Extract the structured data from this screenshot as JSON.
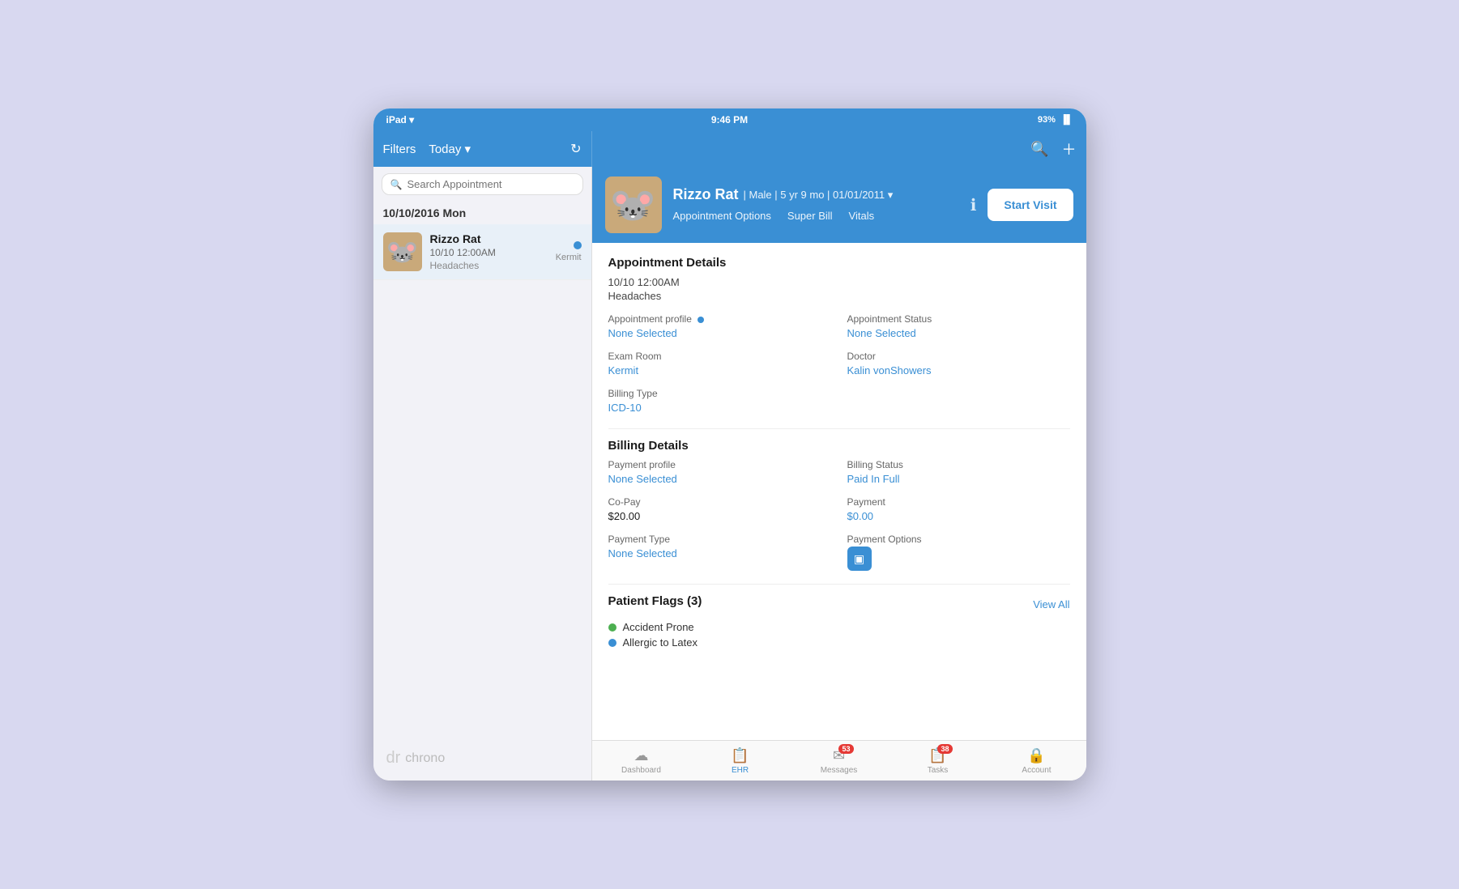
{
  "statusBar": {
    "left": "iPad ▾",
    "center": "9:46 PM",
    "battery": "93%"
  },
  "header": {
    "filtersLabel": "Filters",
    "todayLabel": "Today ▾",
    "refreshIcon": "↻"
  },
  "sidebar": {
    "searchPlaceholder": "Search Appointment",
    "dateHeader": "10/10/2016 Mon",
    "appointments": [
      {
        "name": "Rizzo Rat",
        "time": "10/10 12:00AM",
        "reason": "Headaches",
        "location": "Kermit",
        "hasNotification": true
      }
    ],
    "logoText": "dr chrono"
  },
  "patientHeader": {
    "name": "Rizzo Rat",
    "gender": "Male",
    "age": "5 yr 9 mo",
    "dob": "01/01/2011",
    "tabs": [
      "Appointment Options",
      "Super Bill",
      "Vitals"
    ],
    "startVisitLabel": "Start Visit"
  },
  "appointmentDetails": {
    "sectionTitle": "Appointment Details",
    "datetime": "10/10 12:00AM",
    "chiefComplaint": "Headaches",
    "fields": [
      {
        "label": "Appointment profile",
        "value": "None Selected",
        "hasBlueDot": true
      },
      {
        "label": "Appointment Status",
        "value": "None Selected",
        "hasBlueDot": false
      },
      {
        "label": "Exam Room",
        "value": "Kermit",
        "hasBlueDot": false
      },
      {
        "label": "Doctor",
        "value": "Kalin vonShowers",
        "hasBlueDot": false
      },
      {
        "label": "Billing Type",
        "value": "ICD-10",
        "hasBlueDot": false
      }
    ]
  },
  "billingDetails": {
    "sectionTitle": "Billing Details",
    "fields": [
      {
        "label": "Payment profile",
        "value": "None Selected"
      },
      {
        "label": "Billing Status",
        "value": "Paid In Full"
      },
      {
        "label": "Co-Pay",
        "value": "$20.00",
        "isLink": false
      },
      {
        "label": "Payment",
        "value": "$0.00",
        "isLink": true
      },
      {
        "label": "Payment Type",
        "value": "None Selected",
        "isLink": true
      },
      {
        "label": "Payment Options",
        "value": "",
        "hasIcon": true
      }
    ]
  },
  "patientFlags": {
    "sectionTitle": "Patient Flags",
    "count": 3,
    "viewAllLabel": "View All",
    "flags": [
      {
        "label": "Accident Prone",
        "color": "green"
      },
      {
        "label": "Allergic to Latex",
        "color": "blue"
      }
    ]
  },
  "bottomNav": {
    "items": [
      {
        "icon": "☁",
        "label": "Dashboard",
        "active": false,
        "badge": null
      },
      {
        "icon": "📋",
        "label": "EHR",
        "active": true,
        "badge": null
      },
      {
        "icon": "✉",
        "label": "Messages",
        "active": false,
        "badge": "53"
      },
      {
        "icon": "📋",
        "label": "Tasks",
        "active": false,
        "badge": "38"
      },
      {
        "icon": "🔒",
        "label": "Account",
        "active": false,
        "badge": null
      }
    ]
  }
}
